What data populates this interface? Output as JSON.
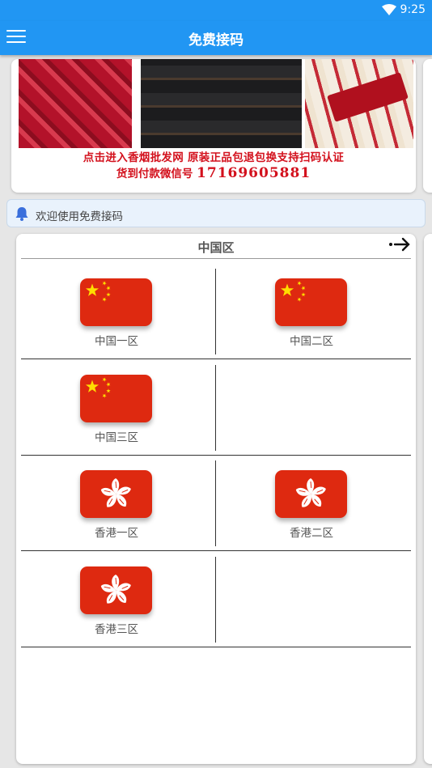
{
  "status_bar": {
    "time": "9:25",
    "wifi_icon": "wifi-icon"
  },
  "app_bar": {
    "title": "免费接码",
    "menu_icon": "hamburger-menu-icon"
  },
  "banner": {
    "line1": "点击进入香烟批发网 原装正品包退包换支持扫码认证",
    "line2_prefix": "货到付款微信号",
    "line2_number": "17169605881"
  },
  "notice": {
    "icon": "bell-icon",
    "text": "欢迎使用免费接码"
  },
  "region": {
    "title": "中国区",
    "next_icon": "arrow-right-icon",
    "rows": [
      {
        "left": {
          "label": "中国一区",
          "flag": "china"
        },
        "right": {
          "label": "中国二区",
          "flag": "china"
        }
      },
      {
        "left": {
          "label": "中国三区",
          "flag": "china"
        },
        "right": null
      },
      {
        "left": {
          "label": "香港一区",
          "flag": "hongkong"
        },
        "right": {
          "label": "香港二区",
          "flag": "hongkong"
        }
      },
      {
        "left": {
          "label": "香港三区",
          "flag": "hongkong"
        },
        "right": null
      }
    ]
  },
  "colors": {
    "primary": "#2196f3",
    "flag_red": "#de2910",
    "flag_yellow": "#ffde00",
    "banner_text": "#d3111d"
  }
}
